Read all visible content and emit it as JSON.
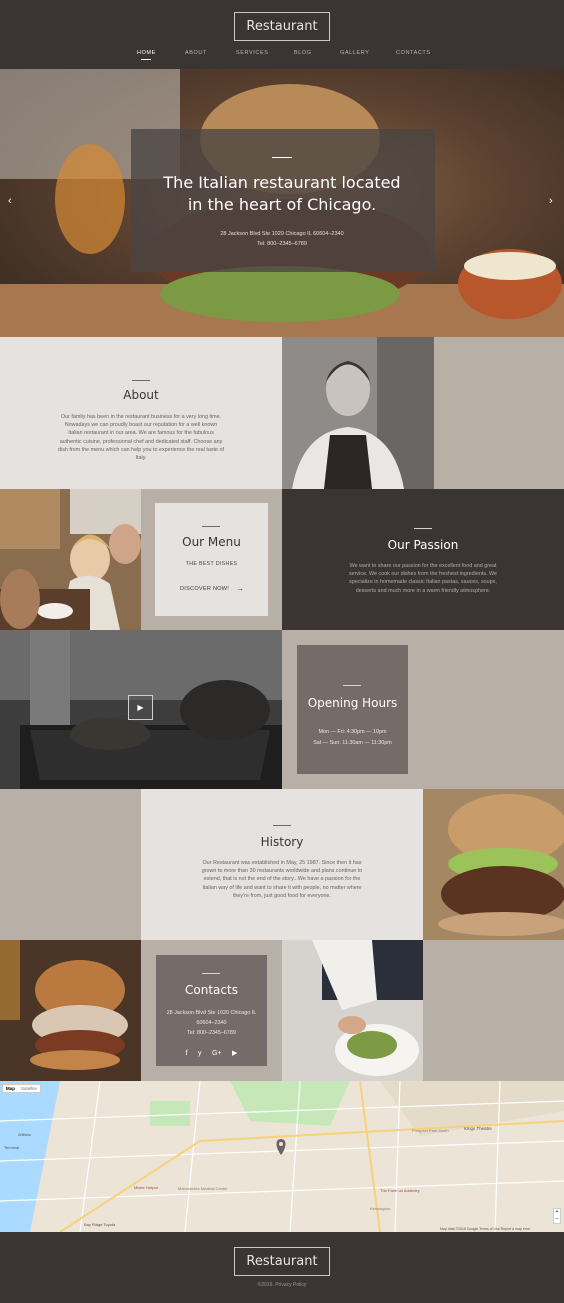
{
  "brand": {
    "logo": "Restaurant"
  },
  "nav": {
    "items": [
      {
        "label": "HOME"
      },
      {
        "label": "ABOUT"
      },
      {
        "label": "SERVICES"
      },
      {
        "label": "BLOG"
      },
      {
        "label": "GALLERY"
      },
      {
        "label": "CONTACTS"
      }
    ]
  },
  "hero": {
    "title_line1": "The Italian restaurant located",
    "title_line2": "in the heart of Chicago.",
    "address": "28 Jackson Blvd Ste 1020 Chicago IL 60604–2340",
    "phone": "Tel: 800–2345–6789",
    "prev_icon": "chevron-left-icon",
    "next_icon": "chevron-right-icon"
  },
  "about": {
    "title": "About",
    "text": "Our family has been in the restaurant business for a very long time. Nowadays we can proudly boast our reputation for a well known Italian restaurant in our area. We are famous for the fabulous authentic cuisine, professional chef and dedicated staff. Choose any dish from the menu which can help you to experience the real taste of Italy."
  },
  "menu": {
    "title": "Our Menu",
    "subtitle": "THE BEST DISHES",
    "cta": "DISCOVER NOW!"
  },
  "passion": {
    "title": "Our Passion",
    "text": "We want to share our passion for the excellent food and great service. We cook our dishes from the freshest ingredients. We specialize in homemade classic Italian pastas, sauces, soups, desserts and much more in a warm friendly atmosphere."
  },
  "hours": {
    "title": "Opening Hours",
    "line1": "Mon — Fri: 4:30pm — 10pm",
    "line2": "Sat — Sun: 11:30am — 11:30pm"
  },
  "history": {
    "title": "History",
    "text": "Our Restaurant was established in May, 25 1987. Since then it has grown to more than 30 restaurants worldwide and plans continue to extend, that is not the end of the story...We have a passion for the Italian way of life and want to share it with people, no matter where they're from, just good food for everyone."
  },
  "contacts": {
    "title": "Contacts",
    "address_line1": "28 Jackson Blvd Ste 1020 Chicago IL",
    "address_line2": "60604–2340",
    "phone": "Tel: 800–2345–6789",
    "social": [
      "f",
      "y",
      "G+",
      "▶"
    ]
  },
  "map": {
    "tab_map": "Map",
    "tab_satellite": "Satellite",
    "streets": [
      "Kings Theatre",
      "Prospect Park South",
      "Maimonides Medical Center",
      "Kensington",
      "The Farm on Adderley",
      "Bay Ridge Toyota",
      "Mister Hotpot",
      "Willsbo",
      "Terminal"
    ],
    "attribution": "Map data ©2016 Google   Terms of Use   Report a map error"
  },
  "footer": {
    "logo": "Restaurant",
    "copyright": "©2016. Privacy Policy"
  },
  "colors": {
    "dark": "#3a3533",
    "taupe": "#b8afa6",
    "light": "#e5e2df",
    "card": "#756c6a"
  }
}
